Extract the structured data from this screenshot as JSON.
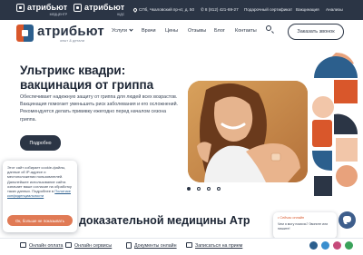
{
  "colors": {
    "dark": "#2b3545",
    "accent_orange": "#d9572b",
    "accent_blue": "#2c5f8d",
    "cookie_button": "#e07a55"
  },
  "topbar": {
    "brand1": "атрибьют",
    "brand1_sub": "МЕДЦЕНТР",
    "brand2": "атрибьют",
    "brand2_sub": "КІДС",
    "address": "СПб, Чкаловский пр-кт, д. 50",
    "phone": "8 (812) 421-69-27",
    "links": [
      "Подарочный сертификат",
      "Вакцинация",
      "Анализы"
    ]
  },
  "nav": {
    "logo_name": "атрибьют",
    "logo_tag": "опыт & детали",
    "items": [
      "Услуги",
      "Врачи",
      "Цены",
      "Отзывы",
      "Блог",
      "Контакты"
    ],
    "cta": "Заказать звонок"
  },
  "hero": {
    "title_line1": "Ультрикс квадри:",
    "title_line2": "вакцинация от гриппа",
    "description": "Обеспечивает надежную защиту от гриппа для людей всех возрастов. Вакцинация помогает уменьшить риск заболевания и его осложнений. Рекомендуется делать прививку ежегодно перед началом сезона гриппа.",
    "button": "Подробно",
    "slides": 4,
    "active_slide": 1
  },
  "section2": {
    "title": "доказательной медицины Атр"
  },
  "cookie": {
    "text": "Этот сайт собирает cookie-файлы, данные об IP-адресе и местоположении пользователей. Дальнейшее использование сайта означает ваше согласие на обработку таких данных. Подробнее в",
    "link": "Политике конфиденциальности",
    "button": "Ок, больше не показывать"
  },
  "chat": {
    "header": "• Сейчас онлайн",
    "message": "Чем я могу помочь? Звоните или пишите!"
  },
  "bottombar": {
    "items": [
      "Онлайн оплата",
      "Онлайн сервисы",
      "Документы онлайн",
      "Записаться на прием"
    ],
    "socials": [
      "vk-icon",
      "telegram-icon",
      "instagram-icon",
      "whatsapp-icon"
    ]
  }
}
